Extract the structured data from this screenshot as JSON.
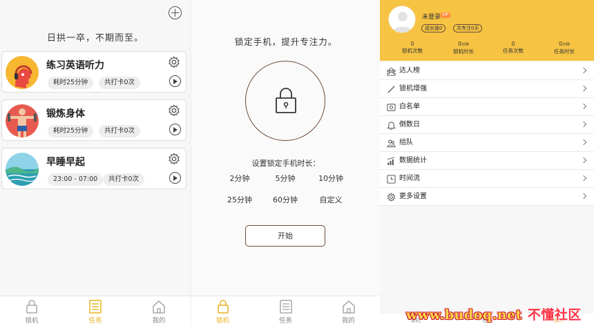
{
  "tasks_panel": {
    "motto": "日拱一卒，不期而至。",
    "tasks": [
      {
        "name": "练习英语听力",
        "duration": "耗时25分钟",
        "checkins": "共打卡0次"
      },
      {
        "name": "锻炼身体",
        "duration": "耗时25分钟",
        "checkins": "共打卡0次"
      },
      {
        "name": "早睡早起",
        "duration": "23:00 - 07:00",
        "checkins": "共打卡0次"
      }
    ]
  },
  "lock_panel": {
    "title": "锁定手机，提升专注力。",
    "duration_label": "设置锁定手机时长：",
    "durations": [
      "2分钟",
      "5分钟",
      "10分钟",
      "25分钟",
      "60分钟",
      "自定义"
    ],
    "start": "开始"
  },
  "nav": {
    "lock": "锁机",
    "tasks": "任务",
    "mine": "我的"
  },
  "profile_panel": {
    "username": "未登录",
    "vip_badge": "VIP",
    "growth_pill": "成长值0",
    "focus_pill": "共专注0天",
    "stats": [
      {
        "value": "0",
        "unit": "",
        "label": "锁机次数"
      },
      {
        "value": "0",
        "unit": "分钟",
        "label": "锁机时长"
      },
      {
        "value": "0",
        "unit": "",
        "label": "任务次数"
      },
      {
        "value": "0",
        "unit": "分钟",
        "label": "任务时长"
      }
    ],
    "menu": [
      {
        "label": "达人榜",
        "icon": "ranking-icon"
      },
      {
        "label": "锁机增强",
        "icon": "magic-wand-icon"
      },
      {
        "label": "白名单",
        "icon": "whitelist-icon"
      },
      {
        "label": "倒数日",
        "icon": "bell-icon"
      },
      {
        "label": "组队",
        "icon": "team-icon"
      },
      {
        "label": "数据统计",
        "icon": "chart-icon"
      },
      {
        "label": "时间流",
        "icon": "timeline-icon"
      },
      {
        "label": "更多设置",
        "icon": "gear-icon"
      }
    ]
  },
  "watermark": {
    "site": "www.budoq.net",
    "cn": "不懂社区"
  },
  "colors": {
    "accent": "#e9b11f",
    "header": "#f6c343",
    "brown": "#6b4a3a"
  }
}
